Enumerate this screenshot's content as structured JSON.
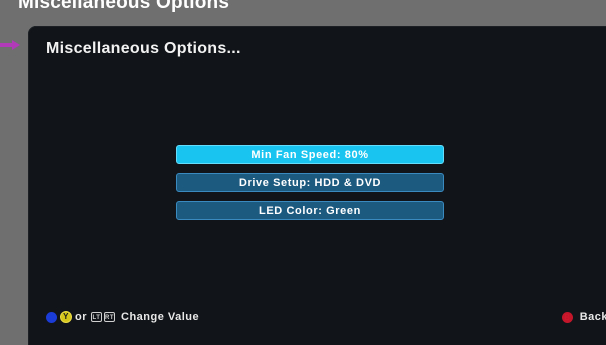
{
  "window": {
    "caption": "Miscellaneous Options"
  },
  "panel": {
    "title": "Miscellaneous Options..."
  },
  "menu": {
    "items": [
      {
        "label": "Min Fan Speed: 80%",
        "selected": true
      },
      {
        "label": "Drive Setup: HDD & DVD",
        "selected": false
      },
      {
        "label": "LED Color: Green",
        "selected": false
      }
    ]
  },
  "footer": {
    "change_value": {
      "x_icon": "X",
      "y_icon": "Y",
      "or_text": "or",
      "lt_icon": "LT",
      "rt_icon": "RT",
      "label": "Change Value"
    },
    "back": {
      "b_icon": "B",
      "label": "Back"
    }
  },
  "colors": {
    "selected": "#19c5f0",
    "item": "#1d5a80",
    "panel_bg": "#111418",
    "marker": "#b03ab8"
  }
}
